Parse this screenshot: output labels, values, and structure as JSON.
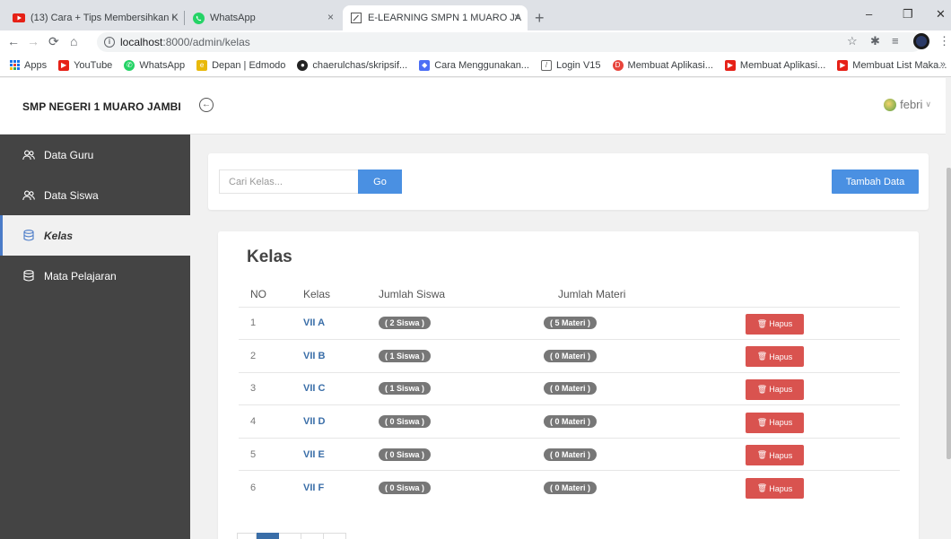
{
  "browser": {
    "tabs": [
      {
        "title": "(13) Cara + Tips Membersihkan K",
        "close": "×",
        "active": false
      },
      {
        "title": "WhatsApp",
        "close": "×",
        "active": false
      },
      {
        "title": "E-LEARNING SMPN 1 MUARO JA",
        "close": "×",
        "active": true
      }
    ],
    "new_tab": "+",
    "window_controls": {
      "minimize": "–",
      "restore": "❐",
      "close": "✕"
    },
    "url_host": "localhost",
    "url_path": ":8000/admin/kelas",
    "bookmarks": [
      {
        "label": "Apps",
        "icon": "apps-grid-icon",
        "color": "#1a73e8"
      },
      {
        "label": "YouTube",
        "icon": "youtube-icon",
        "color": "#e62117"
      },
      {
        "label": "WhatsApp",
        "icon": "whatsapp-icon",
        "color": "#25d366"
      },
      {
        "label": "Depan | Edmodo",
        "icon": "edmodo-icon",
        "color": "#e8b90b"
      },
      {
        "label": "chaerulchas/skripsif...",
        "icon": "github-icon",
        "color": "#222222"
      },
      {
        "label": "Cara Menggunakan...",
        "icon": "bookmark-icon",
        "color": "#4c6ef5"
      },
      {
        "label": "Login V15",
        "icon": "bookmark-icon",
        "color": "#666666"
      },
      {
        "label": "Membuat Aplikasi...",
        "icon": "bookmark-icon",
        "color": "#e8453c"
      },
      {
        "label": "Membuat Aplikasi...",
        "icon": "youtube-icon",
        "color": "#e62117"
      },
      {
        "label": "Membuat List Maka...",
        "icon": "youtube-icon",
        "color": "#e62117"
      }
    ],
    "bookmarks_more": "»"
  },
  "header": {
    "brand": "SMP NEGERI 1 MUARO JAMBI",
    "user_name": "febri"
  },
  "sidebar": {
    "items": [
      {
        "label": "Data Guru",
        "icon": "users-icon",
        "active": false
      },
      {
        "label": "Data Siswa",
        "icon": "users-icon",
        "active": false
      },
      {
        "label": "Kelas",
        "icon": "database-icon",
        "active": true
      },
      {
        "label": "Mata Pelajaran",
        "icon": "database-icon",
        "active": false
      }
    ]
  },
  "search": {
    "placeholder": "Cari Kelas...",
    "go_label": "Go",
    "add_label": "Tambah Data"
  },
  "table": {
    "title": "Kelas",
    "columns": [
      "NO",
      "Kelas",
      "Jumlah Siswa",
      "Jumlah Materi",
      ""
    ],
    "delete_label": "Hapus",
    "rows": [
      {
        "no": "1",
        "kelas": "VII A",
        "siswa": "( 2 Siswa )",
        "materi": "( 5 Materi )"
      },
      {
        "no": "2",
        "kelas": "VII B",
        "siswa": "( 1 Siswa )",
        "materi": "( 0 Materi )"
      },
      {
        "no": "3",
        "kelas": "VII C",
        "siswa": "( 1 Siswa )",
        "materi": "( 0 Materi )"
      },
      {
        "no": "4",
        "kelas": "VII D",
        "siswa": "( 0 Siswa )",
        "materi": "( 0 Materi )"
      },
      {
        "no": "5",
        "kelas": "VII E",
        "siswa": "( 0 Siswa )",
        "materi": "( 0 Materi )"
      },
      {
        "no": "6",
        "kelas": "VII F",
        "siswa": "( 0 Siswa )",
        "materi": "( 0 Materi )"
      }
    ]
  },
  "colors": {
    "sidebar_bg": "#444444",
    "primary": "#4a90e2",
    "danger": "#d9534f",
    "link": "#3a6ea8",
    "badge": "#777777"
  }
}
